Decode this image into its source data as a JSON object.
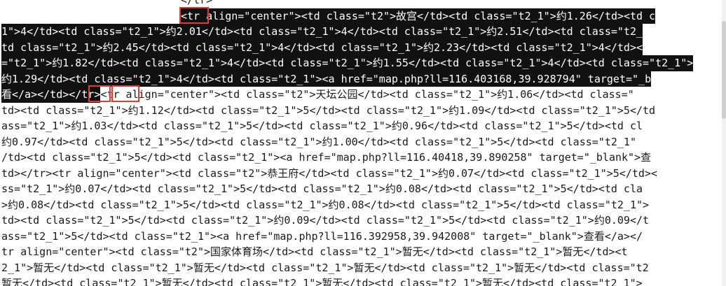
{
  "viewer": {
    "lines": [
      {
        "pre": "",
        "sel": "",
        "post": "</tr>"
      },
      {
        "pre": "",
        "sel": "<tr align=\"center\"><td class=\"t2\">故宫</td><td class=\"t2_1\">约1.26</td><td c",
        "post": ""
      },
      {
        "pre": "",
        "sel": "1\">4</td><td class=\"t2_1\">约2.01</td><td class=\"t2_1\">4</td><td class=\"t2_1\">约2.51</td><td class=\"t2_",
        "post": ""
      },
      {
        "pre": "",
        "sel": "td class=\"t2_1\">约2.45</td><td class=\"t2_1\">4</td><td class=\"t2_1\">约2.23</td><td class=\"t2_1\">4</td><",
        "post": ""
      },
      {
        "pre": "",
        "sel": "=\"t2_1\">约1.82</td><td class=\"t2_1\">4</td><td class=\"t2_1\">约1.55</td><td class=\"t2_1\">4</td><td class=\"t2_1\">",
        "post": ""
      },
      {
        "pre": "",
        "sel": "约1.29</td><td class=\"t2_1\">4</td><td class=\"t2_1\"><a href=\"map.php?ll=116.403168,39.928794\" target=\"_b",
        "post": ""
      },
      {
        "pre": "",
        "sel": "看</a></td></tr>",
        "post": "<tr align=\"center\"><td class=\"t2\">天坛公园</td><td class=\"t2_1\">约1.06</td><td class=\""
      },
      {
        "pre": "",
        "sel": "",
        "post": "td><td class=\"t2_1\">约1.12</td><td class=\"t2_1\">5</td><td class=\"t2_1\">约1.09</td><td class=\"t2_1\">5</td"
      },
      {
        "pre": "",
        "sel": "",
        "post": "ass=\"t2_1\">约1.03</td><td class=\"t2_1\">5</td><td class=\"t2_1\">约0.96</td><td class=\"t2_1\">5</td><td cl"
      },
      {
        "pre": "",
        "sel": "",
        "post": "约0.97</td><td class=\"t2_1\">5</td><td class=\"t2_1\">约1.00</td><td class=\"t2_1\">5</td><td class=\"t2_1\""
      },
      {
        "pre": "",
        "sel": "",
        "post": "/td><td class=\"t2_1\">5</td><td class=\"t2_1\"><a href=\"map.php?ll=116.40418,39.890258\" target=\"_blank\">查"
      },
      {
        "pre": "",
        "sel": "",
        "post": "td></tr><tr align=\"center\"><td class=\"t2\">恭王府</td><td class=\"t2_1\">约0.07</td><td class=\"t2_1\">5</td><"
      },
      {
        "pre": "",
        "sel": "",
        "post": "ss=\"t2_1\">约0.07</td><td class=\"t2_1\">5</td><td class=\"t2_1\">约0.08</td><td class=\"t2_1\">5</td><td cla"
      },
      {
        "pre": "",
        "sel": "",
        "post": ">约0.08</td><td class=\"t2_1\">5</td><td class=\"t2_1\">约0.08</td><td class=\"t2_1\">5</td><td class=\"t2_1\">"
      },
      {
        "pre": "",
        "sel": "",
        "post": "td><td class=\"t2_1\">5</td><td class=\"t2_1\">约0.09</td><td class=\"t2_1\">5</td><td class=\"t2_1\">约0.09</t"
      },
      {
        "pre": "",
        "sel": "",
        "post": "ass=\"t2_1\">5</td><td class=\"t2_1\"><a href=\"map.php?ll=116.392958,39.942008\" target=\"_blank\">查看</a></"
      },
      {
        "pre": "",
        "sel": "",
        "post": "tr align=\"center\"><td class=\"t2\">国家体育场</td><td class=\"t2_1\">暂无</td><td class=\"t2_1\">暂无</td><t"
      },
      {
        "pre": "",
        "sel": "",
        "post": "2_1\">暂无</td><td class=\"t2_1\">暂无</td><td class=\"t2_1\">暂无</td><td class=\"t2_1\">暂无</td><td class=\"t2"
      },
      {
        "pre": "",
        "sel": "",
        "post": "暂无</td><td class=\"t2_1\">暂无</td><td class=\"t2_1\">暂无</td><td class=\"t2_1\">暂无</td><td class=\"t2_1\">"
      }
    ]
  }
}
